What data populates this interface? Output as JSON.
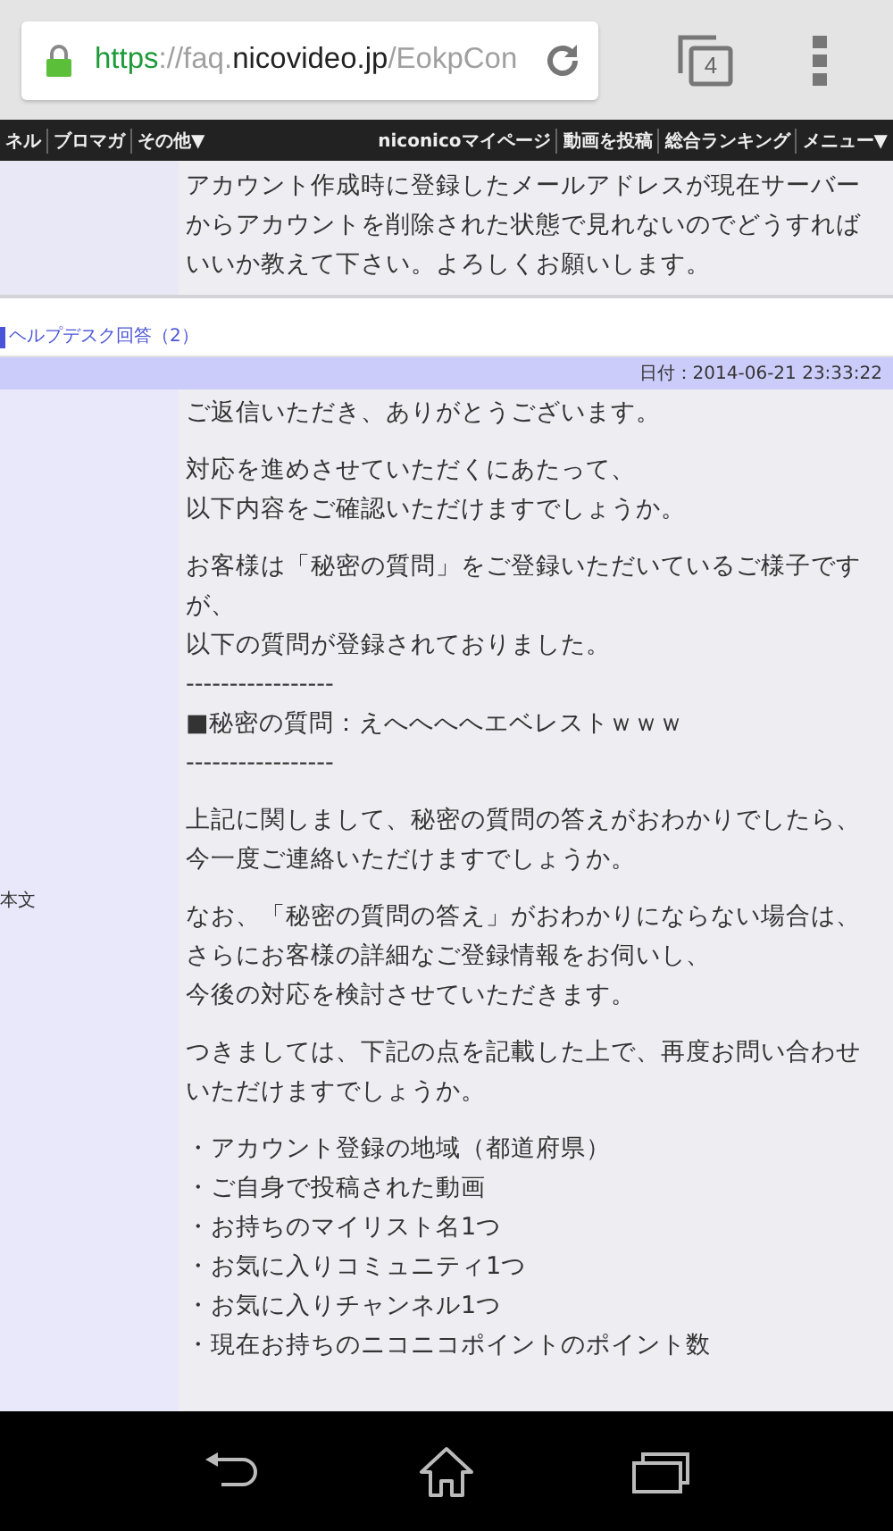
{
  "browser": {
    "url": [
      {
        "text": "https",
        "kind": "scheme"
      },
      {
        "text": "://faq.",
        "kind": "dim"
      },
      {
        "text": "nicovideo.jp",
        "kind": "host"
      },
      {
        "text": "/EokpCon",
        "kind": "dim"
      }
    ],
    "tab_count": "4"
  },
  "site_nav": {
    "left": [
      "ネル",
      "ブロマガ",
      "その他▼"
    ],
    "right": [
      "niconicoマイページ",
      "動画を投稿",
      "総合ランキング",
      "メニュー▼"
    ]
  },
  "question": {
    "lines": [
      "アカウント作成時に登録したメールアドレスが現在サーバー",
      "からアカウントを削除された状態で見れないのでどうすれば",
      "いいか教えて下さい。よろしくお願いします。"
    ]
  },
  "answer": {
    "heading": "ヘルプデスク回答（2）",
    "date": "日付：2014-06-21 23:33:22",
    "label": "本文",
    "paragraphs": [
      [
        "ご返信いただき、ありがとうございます。"
      ],
      [
        "対応を進めさせていただくにあたって、",
        "以下内容をご確認いただけますでしょうか。"
      ],
      [
        "お客様は「秘密の質問」をご登録いただいているご様子です",
        "が、",
        "以下の質問が登録されておりました。",
        "-----------------",
        "■秘密の質問：えへへへへエベレストｗｗｗ",
        "-----------------"
      ],
      [
        "上記に関しまして、秘密の質問の答えがおわかりでしたら、",
        "今一度ご連絡いただけますでしょうか。"
      ],
      [
        "なお、「秘密の質問の答え」がおわかりにならない場合は、",
        "さらにお客様の詳細なご登録情報をお伺いし、",
        "今後の対応を検討させていただきます。"
      ],
      [
        "つきましては、下記の点を記載した上で、再度お問い合わせ",
        "いただけますでしょうか。"
      ],
      [
        "・アカウント登録の地域（都道府県）",
        "・ご自身で投稿された動画",
        "・お持ちのマイリスト名1つ",
        "・お気に入りコミュニティ1つ",
        "・お気に入りチャンネル1つ",
        "・現在お持ちのニコニコポイントのポイント数"
      ]
    ]
  }
}
